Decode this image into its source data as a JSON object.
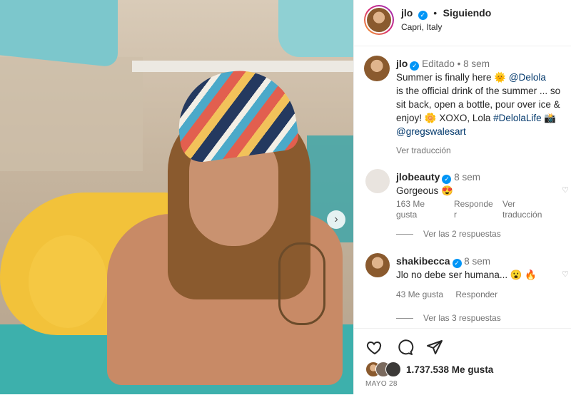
{
  "post": {
    "username": "jlo",
    "follow_status": "Siguiendo",
    "separator": "•",
    "location": "Capri, Italy"
  },
  "caption": {
    "username": "jlo",
    "edited": "Editado",
    "dot": "•",
    "time": "8 sem",
    "line1": "Summer is finally here 🌞 ",
    "mention": "@Delola",
    "line2": " is the official drink of the summer ... so sit back, open a bottle, pour over ice & enjoy! 🌼 XOXO, Lola ",
    "hashtag": "#DelolaLife",
    "camera": " 📸",
    "credit": "@gregswalesart",
    "translate": "Ver traducción"
  },
  "comments": [
    {
      "username": "jlobeauty",
      "time": "8 sem",
      "text": "Gorgeous 😍",
      "likes": "163 Me gusta",
      "reply": "Responder",
      "translate": "Ver traducción",
      "view_replies": "Ver las 2 respuestas"
    },
    {
      "username": "shakibecca",
      "time": "8 sem",
      "text": "Jlo no debe ser humana... 😮 🔥",
      "likes": "43 Me gusta",
      "reply": "Responder",
      "view_replies": "Ver las 3 respuestas"
    }
  ],
  "actions": {
    "like_icon": "heart-icon",
    "comment_icon": "comment-icon",
    "share_icon": "send-icon",
    "likes_count": "1.737.538 Me gusta",
    "date": "MAYO 28"
  },
  "colors": {
    "verified": "#0095f6",
    "link": "#00376b",
    "muted": "#737373"
  }
}
